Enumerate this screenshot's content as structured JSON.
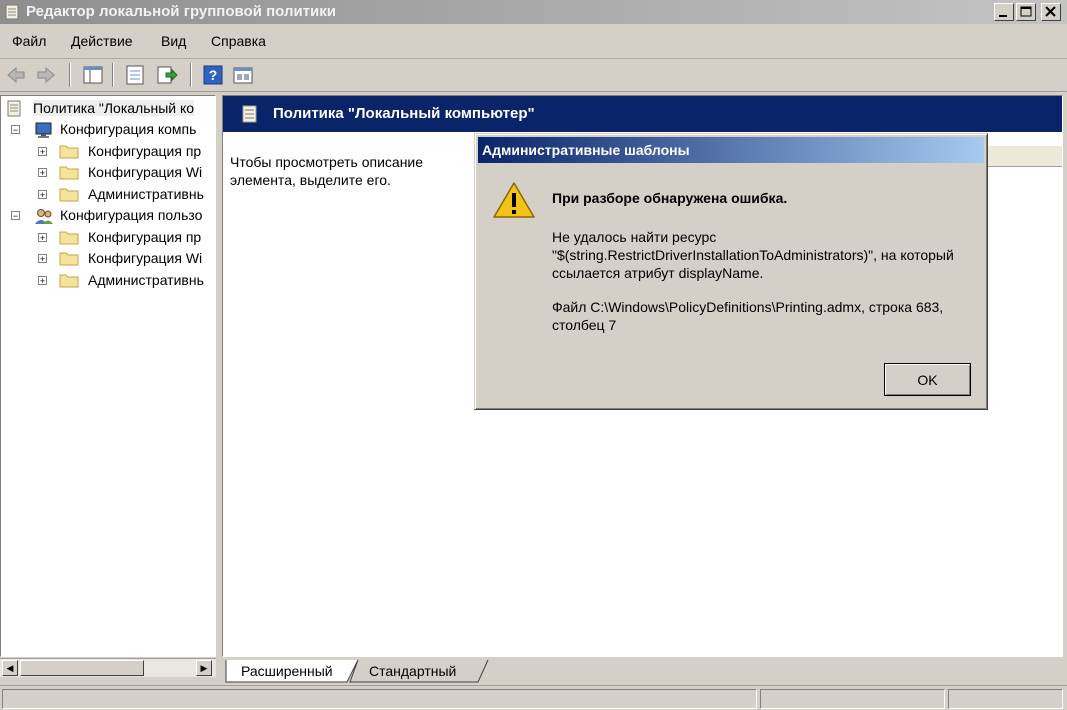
{
  "window": {
    "title": "Редактор локальной групповой политики",
    "controls": [
      "_",
      "□",
      "×"
    ]
  },
  "menu": {
    "items": [
      {
        "label": "Файл"
      },
      {
        "label": "Действие"
      },
      {
        "label": "Вид"
      },
      {
        "label": "Справка"
      }
    ]
  },
  "toolbar": {
    "icons": [
      "back-arrow-icon",
      "forward-arrow-icon",
      "show-hide-tree-icon",
      "properties-icon",
      "export-list-icon",
      "help-icon",
      "view-icon"
    ]
  },
  "tree": {
    "root": "Политика \"Локальный ко",
    "computer": {
      "label": "Конфигурация компь",
      "children": [
        "Конфигурация пр",
        "Конфигурация Wi",
        "Административнь"
      ]
    },
    "user": {
      "label": "Конфигурация пользо",
      "children": [
        "Конфигурация пр",
        "Конфигурация Wi",
        "Административнь"
      ]
    }
  },
  "right_pane": {
    "header": "Политика \"Локальный компьютер\"",
    "description": "Чтобы просмотреть описание элемента, выделите его."
  },
  "tabs": {
    "extended": "Расширенный",
    "standard": "Стандартный"
  },
  "dialog": {
    "title": "Административные шаблоны",
    "heading": "При разборе обнаружена ошибка.",
    "body": "Не удалось найти ресурс \"$(string.RestrictDriverInstallationToAdministrators)\", на который ссылается атрибут displayName.",
    "file": "Файл C:\\Windows\\PolicyDefinitions\\Printing.admx, строка 683, столбец 7",
    "ok_label": "OK"
  }
}
